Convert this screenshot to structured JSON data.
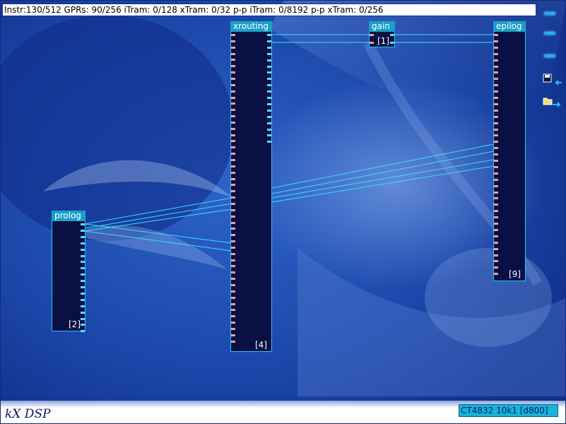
{
  "status_bar": {
    "text": "Instr:130/512 GPRs: 90/256 iTram: 0/128 xTram: 0/32 p-p iTram: 0/8192 p-p xTram: 0/256"
  },
  "blocks": [
    {
      "id": "prolog",
      "title": "prolog",
      "number": "[2]"
    },
    {
      "id": "xrouting",
      "title": "xrouting",
      "number": "[4]"
    },
    {
      "id": "gain",
      "title": "gain",
      "number": "[1]"
    },
    {
      "id": "epilog",
      "title": "epilog",
      "number": "[9]"
    }
  ],
  "toolbar": {
    "icons": [
      "menu-icon",
      "menu-icon",
      "menu-icon",
      "save-icon",
      "load-icon"
    ]
  },
  "footer": {
    "brand": "kX DSP",
    "device": "CT4832 10k1 [d800]"
  },
  "colors": {
    "wire": "#33e0ff",
    "block_fill": "#0a0f44",
    "title_fill": "#1a9fc8",
    "pin_input": "#ff9aa0",
    "pin_output": "#58d8ff"
  }
}
